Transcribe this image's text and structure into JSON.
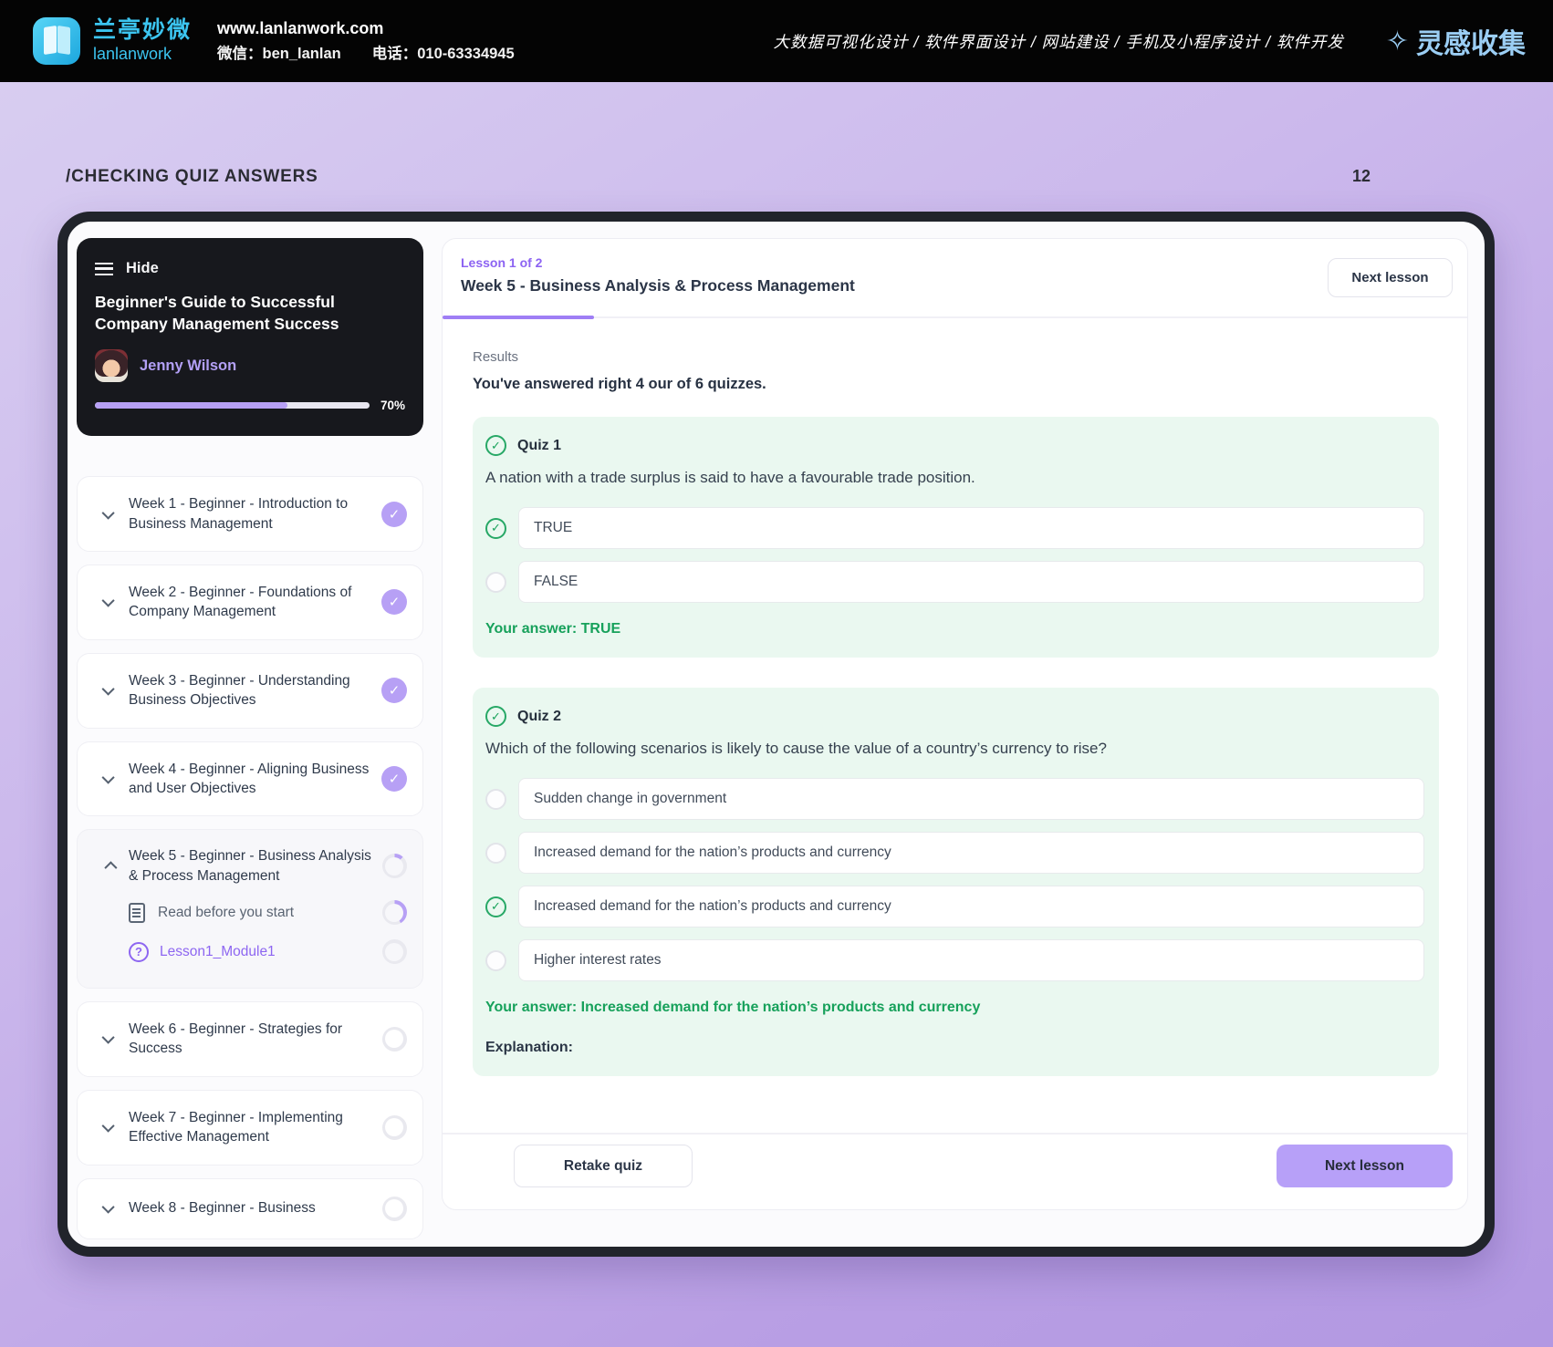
{
  "topbar": {
    "brand_cn": "兰亭妙微",
    "brand_en": "lanlanwork",
    "website": "www.lanlanwork.com",
    "wechat": "微信：ben_lanlan",
    "phone": "电话：010-63334945",
    "services": "大数据可视化设计 / 软件界面设计 / 网站建设 / 手机及小程序设计 / 软件开发",
    "collect_logo": "灵感收集",
    "collect_star_icon": "✧"
  },
  "page": {
    "slide_label": "/CHECKING QUIZ ANSWERS",
    "page_number": "12"
  },
  "sidebar": {
    "hide_label": "Hide",
    "course_title": "Beginner's Guide to Successful Company Management Success",
    "instructor": "Jenny Wilson",
    "progress_value": 70,
    "progress_percent": "70%",
    "weeks": [
      {
        "label": "Week 1 - Beginner - Introduction to Business Management",
        "state": "done"
      },
      {
        "label": "Week 2 - Beginner - Foundations of Company Management",
        "state": "done"
      },
      {
        "label": "Week 3 - Beginner - Understanding Business Objectives",
        "state": "done"
      },
      {
        "label": "Week 4 - Beginner - Aligning Business and User Objectives",
        "state": "done"
      },
      {
        "label": "Week 5 - Beginner - Business Analysis & Process Management",
        "state": "in-progress",
        "expanded": true,
        "sub_items": [
          {
            "label": "Read before you start",
            "icon": "document-icon"
          },
          {
            "label": "Lesson1_Module1",
            "icon": "question-icon"
          }
        ]
      },
      {
        "label": "Week 6 - Beginner - Strategies for Success",
        "state": "todo"
      },
      {
        "label": "Week 7 - Beginner - Implementing Effective Management",
        "state": "todo"
      },
      {
        "label": "Week 8 - Beginner - Business",
        "state": "todo",
        "clipped": true
      }
    ],
    "check_glyph": "✓"
  },
  "content": {
    "lesson_counter": "Lesson 1 of 2",
    "lesson_title": "Week 5 - Business Analysis & Process Management",
    "next_lesson_label": "Next lesson",
    "results_label": "Results",
    "results_summary": "You've answered right 4 our of 6 quizzes.",
    "quizzes": [
      {
        "label": "Quiz 1",
        "question": "A nation with a trade surplus is said to have a favourable trade position.",
        "options": [
          {
            "text": "TRUE",
            "marked_correct": true
          },
          {
            "text": "FALSE",
            "marked_correct": false
          }
        ],
        "your_answer": "Your answer: TRUE"
      },
      {
        "label": "Quiz 2",
        "question": "Which of the following scenarios is likely to cause the value of a country’s currency to rise?",
        "options": [
          {
            "text": "Sudden change in government",
            "marked_correct": false
          },
          {
            "text": "Increased demand for the nation’s products and currency",
            "marked_correct": false
          },
          {
            "text": "Increased demand for the nation’s products and currency",
            "marked_correct": true
          },
          {
            "text": "Higher interest rates",
            "marked_correct": false
          }
        ],
        "your_answer": "Your answer: Increased demand for the nation’s products and currency",
        "explanation_label": "Explanation:"
      }
    ],
    "footer": {
      "retake_label": "Retake quiz",
      "next_label": "Next lesson"
    }
  },
  "colors": {
    "accent_purple": "#b7a0f5",
    "underline_purple": "#9f7ef5",
    "link_purple": "#8c63f2",
    "success_green": "#1aa35c",
    "quiz_card_mint": "#eaf8f0",
    "brand_cyan": "#3cc5f0",
    "collect_blue": "#9bcef4",
    "frame_dark": "#21242b",
    "background_lavender": "#c3aee9"
  }
}
